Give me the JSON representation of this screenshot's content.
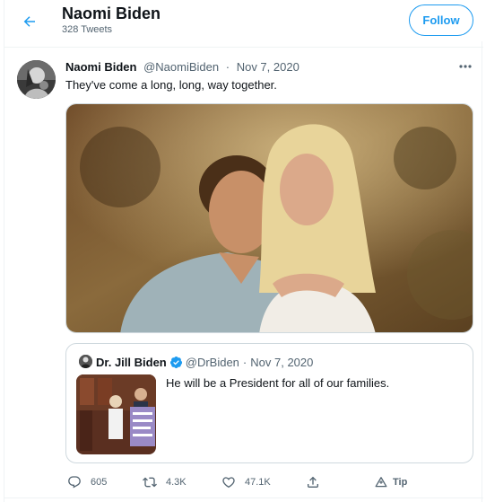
{
  "header": {
    "name": "Naomi Biden",
    "tweet_count": "328 Tweets",
    "follow_label": "Follow"
  },
  "tweet": {
    "author_name": "Naomi Biden",
    "handle": "@NaomiBiden",
    "separator": "·",
    "date": "Nov 7, 2020",
    "text": "They've come a long, long, way together.",
    "quote": {
      "author_name": "Dr. Jill Biden",
      "handle": "@DrBiden",
      "separator": "·",
      "date": "Nov 7, 2020",
      "text": "He will be a President for all of our families."
    },
    "actions": {
      "replies": "605",
      "retweets": "4.3K",
      "likes": "47.1K",
      "tip_label": "Tip"
    }
  },
  "icons": {
    "back": "arrow-left-icon",
    "more": "more-horizontal-icon",
    "verified": "verified-badge-icon",
    "reply": "reply-icon",
    "retweet": "retweet-icon",
    "like": "heart-icon",
    "share": "share-icon",
    "tip": "tip-icon"
  },
  "colors": {
    "accent": "#1d9bf0",
    "text_primary": "#0f1419",
    "text_secondary": "#536471",
    "border": "#cfd9de"
  }
}
